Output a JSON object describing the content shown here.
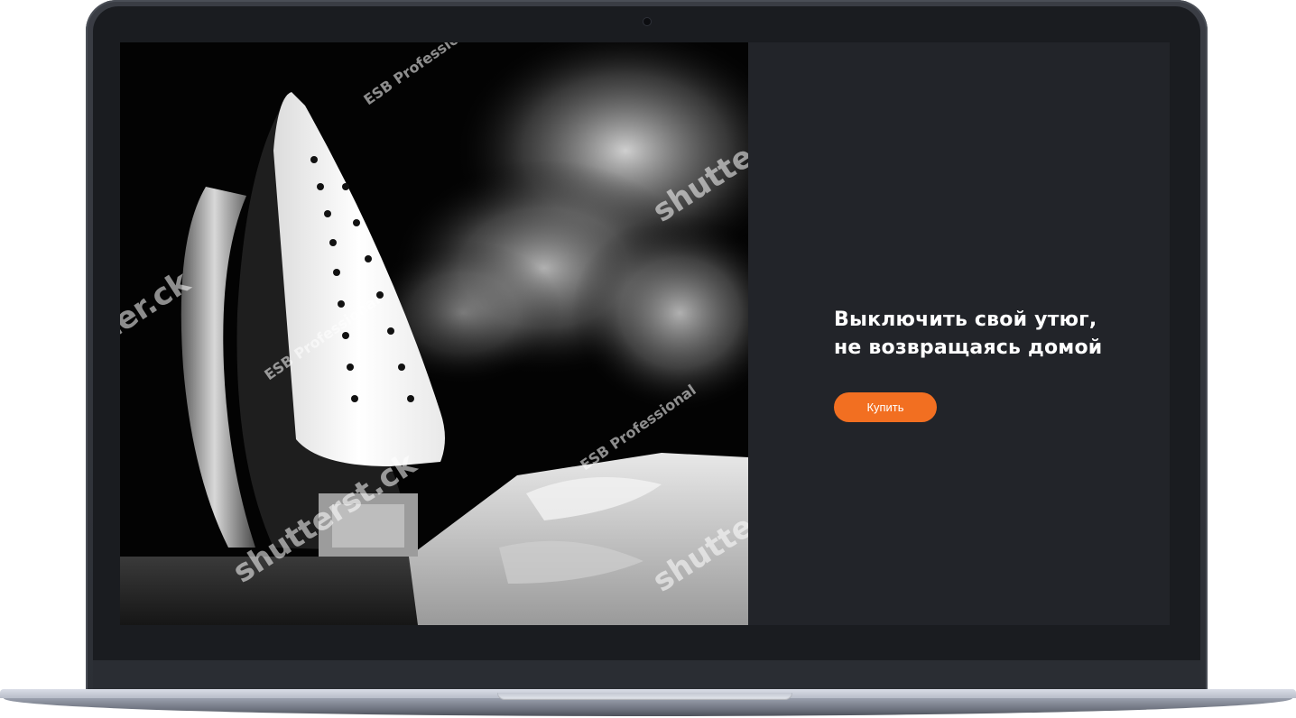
{
  "promo": {
    "headline_line1": "Выключить свой утюг,",
    "headline_line2": "не возвращаясь домой",
    "button_label": "Купить"
  },
  "photo": {
    "subject": "steam iron with steam cloud over folded shirt",
    "watermarks": [
      "shutterstock",
      "ESB Professional"
    ]
  },
  "colors": {
    "accent": "#f26f21",
    "screen_background": "#222429",
    "headline_text": "#ffffff"
  }
}
